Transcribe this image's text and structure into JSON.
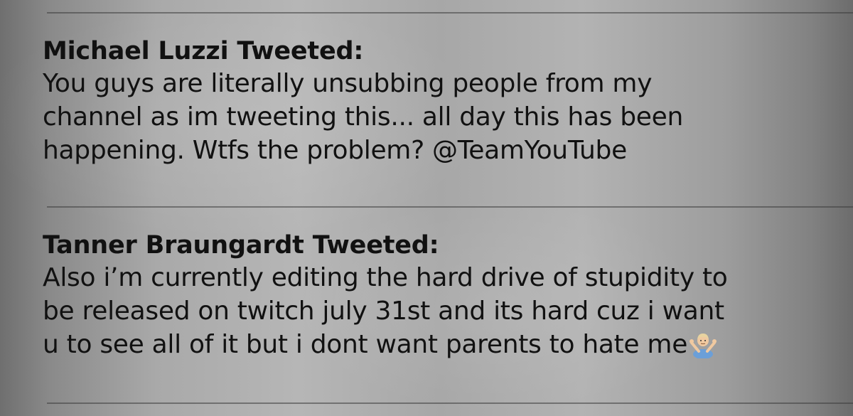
{
  "notifications": [
    {
      "title": "Michael Luzzi Tweeted:",
      "lines": [
        "You guys are literally unsubbing people from my",
        "channel as im tweeting this... all day this has been",
        "happening. Wtfs the problem? @TeamYouTube"
      ]
    },
    {
      "title": "Tanner Braungardt Tweeted:",
      "lines": [
        "Also i’m currently editing the hard drive of stupidity to",
        "be released on twitch july 31st and its hard cuz i want",
        "u to see all of it but i dont want parents to hate me"
      ],
      "trailing_emoji": "person-shrugging-icon"
    }
  ],
  "colors": {
    "text": "#111111",
    "divider": "#555555",
    "background": "#a9a9a9"
  }
}
